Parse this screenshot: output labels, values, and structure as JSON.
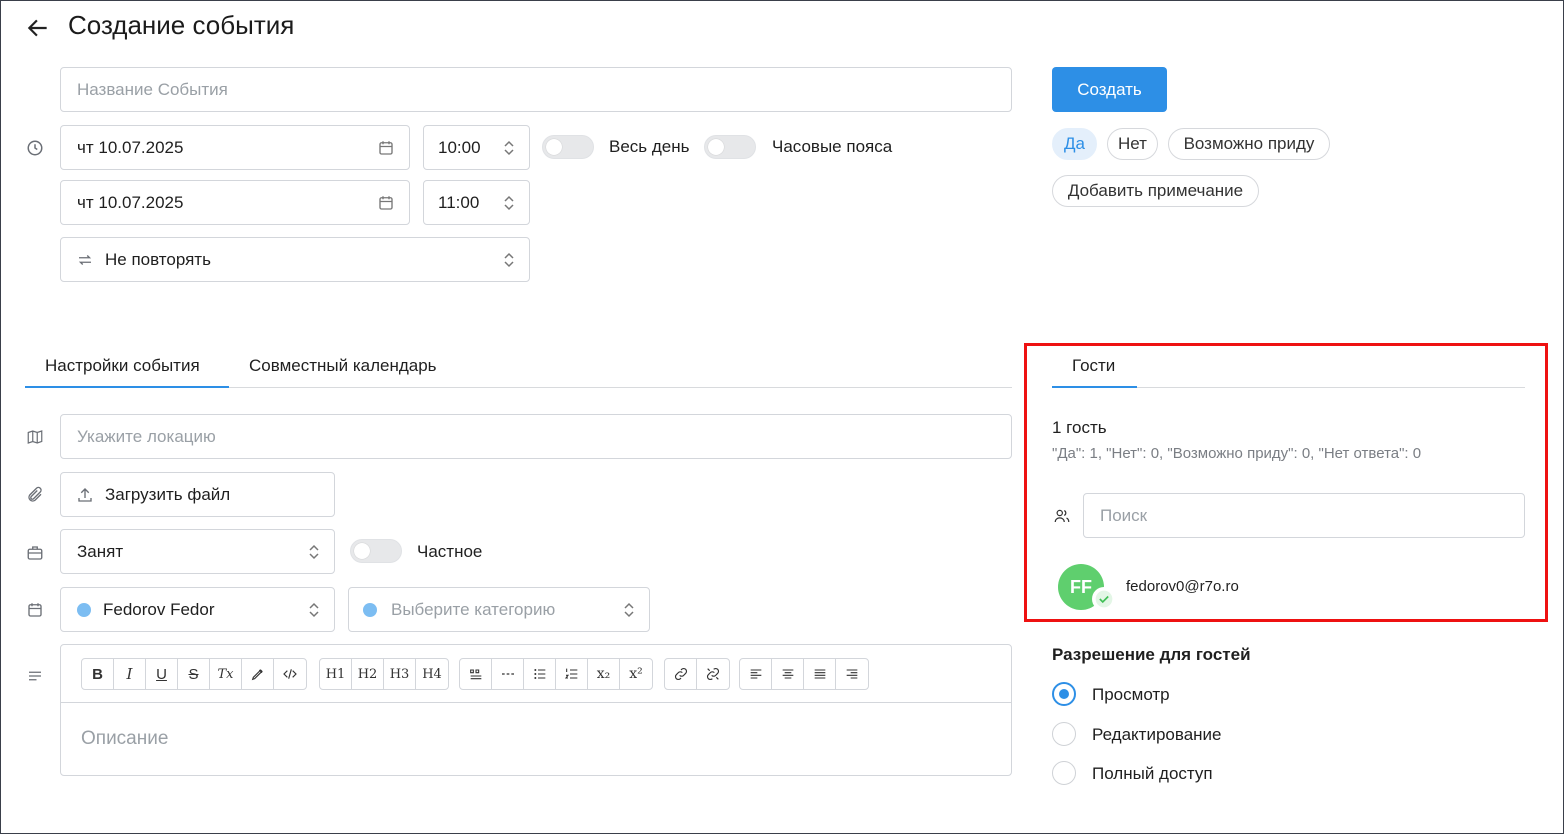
{
  "header": {
    "title": "Создание события"
  },
  "event": {
    "name_placeholder": "Название События",
    "start_date": "чт 10.07.2025",
    "start_time": "10:00",
    "end_date": "чт 10.07.2025",
    "end_time": "11:00",
    "all_day_label": "Весь день",
    "timezones_label": "Часовые пояса",
    "repeat_value": "Не повторять"
  },
  "actions": {
    "create_label": "Создать",
    "rsvp": [
      "Да",
      "Нет",
      "Возможно приду"
    ],
    "add_note_label": "Добавить примечание"
  },
  "tabs": {
    "settings": "Настройки события",
    "shared_calendar": "Совместный календарь"
  },
  "settings": {
    "location_placeholder": "Укажите локацию",
    "upload_label": "Загрузить файл",
    "busy_value": "Занят",
    "private_label": "Частное",
    "calendar_value": "Fedorov Fedor",
    "category_placeholder": "Выберите категорию",
    "description_placeholder": "Описание",
    "toolbar": {
      "bold": "B",
      "italic": "I",
      "underline": "U",
      "strike": "S",
      "clear": "Tx",
      "h1": "H1",
      "h2": "H2",
      "h3": "H3",
      "h4": "H4",
      "subscript": "x₂",
      "superscript": "x²"
    }
  },
  "guests": {
    "tab_label": "Гости",
    "count_label": "1 гость",
    "summary": "\"Да\": 1, \"Нет\": 0, \"Возможно приду\": 0, \"Нет ответа\": 0",
    "search_placeholder": "Поиск",
    "list": [
      {
        "initials": "FF",
        "email": "fedorov0@r7o.ro"
      }
    ]
  },
  "permissions": {
    "title": "Разрешение для гостей",
    "options": [
      "Просмотр",
      "Редактирование",
      "Полный доступ"
    ],
    "selected": "Просмотр"
  },
  "colors": {
    "accent": "#2d8fe6",
    "avatar": "#5fcf6e",
    "highlight": "#ee1111",
    "calendar_dot": "#7cbdf2"
  }
}
